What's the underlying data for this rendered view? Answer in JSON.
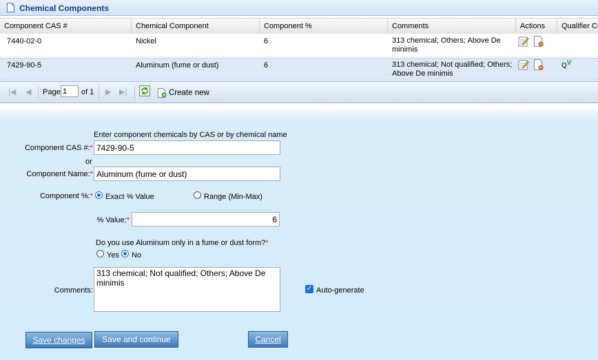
{
  "panel": {
    "title": "Chemical Components"
  },
  "columns": [
    "Component CAS #",
    "Chemical Component",
    "Component %",
    "Comments",
    "Actions",
    "Qualifier Cu"
  ],
  "rows": [
    {
      "cas": "7440-02-0",
      "component": "Nickel",
      "percent": "6",
      "comments_1": "313 chemical; Others; Above De",
      "comments_2": "minimis",
      "qualifier": ""
    },
    {
      "cas": "7429-90-5",
      "component": "Aluminum (fume or dust)",
      "percent": "6",
      "comments_1": "313 chemical; Not qualified; Others;",
      "comments_2": "Above De minimis",
      "qualifier": "Q",
      "qualifier_mark": "V"
    }
  ],
  "pager": {
    "page_label": "Page",
    "page_value": "1",
    "of_label": "of 1",
    "create_new": "Create new"
  },
  "form": {
    "hint": "Enter component chemicals by CAS or by chemical name",
    "cas_label": "Component CAS #:",
    "cas_value": "7429-90-5",
    "or_label": "or",
    "name_label": "Component Name:",
    "name_value": "Aluminum (fume or dust)",
    "percent_label": "Component %:",
    "exact_label": "Exact % Value",
    "range_label": "Range (Min-Max)",
    "value_label": "% Value:",
    "value_value": "6",
    "fume_question": "Do you use Aluminum only in a fume or dust form?",
    "yes_label": "Yes",
    "no_label": "No",
    "comments_label": "Comments:",
    "comments_value": "313 chemical; Not qualified; Others; Above De minimis",
    "autogen_label": "Auto-generate",
    "required_mark": "*"
  },
  "buttons": {
    "save_changes": "Save changes",
    "save_continue": "Save and continue",
    "cancel": "Cancel"
  },
  "icons": [
    "document-icon",
    "edit-icon",
    "delete-icon",
    "first-page-icon",
    "prev-page-icon",
    "next-page-icon",
    "last-page-icon",
    "refresh-icon",
    "create-new-icon"
  ]
}
